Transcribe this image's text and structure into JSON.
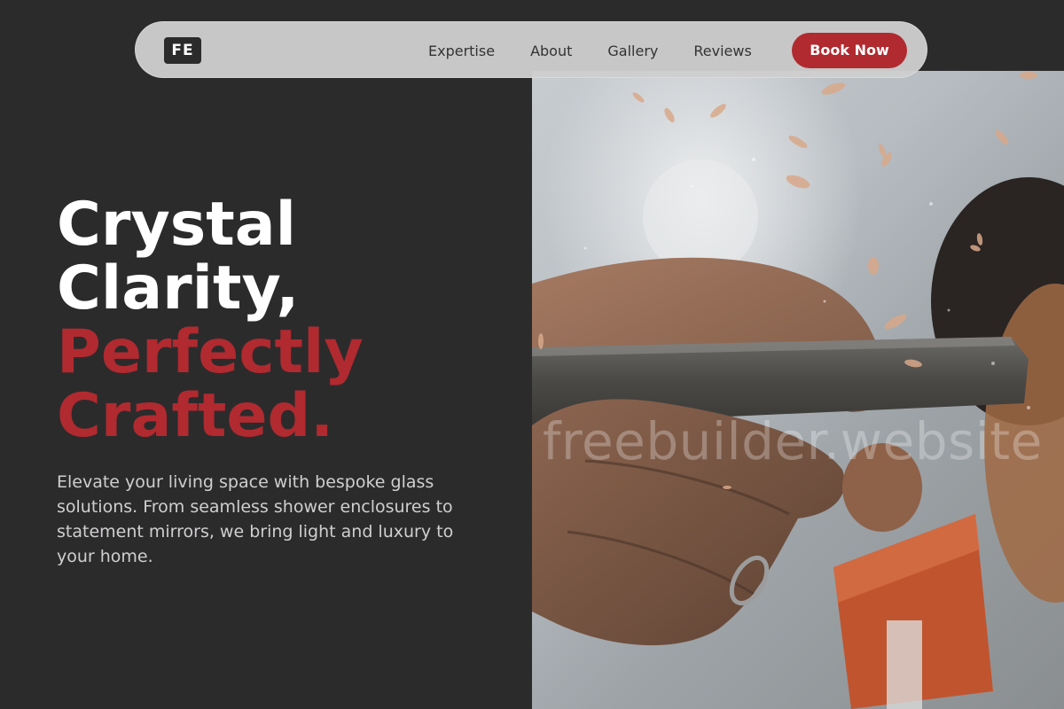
{
  "navbar": {
    "logo_text": "FE",
    "links": [
      "Expertise",
      "About",
      "Gallery",
      "Reviews"
    ],
    "cta_label": "Book Now"
  },
  "hero": {
    "headline_line1": "Crystal",
    "headline_line2": "Clarity,",
    "headline_line3": "Perfectly",
    "headline_line4": "Crafted.",
    "subtext": "Elevate your living space with bespoke glass solutions. From seamless shower enclosures to statement mirrors, we bring light and luxury to your home.",
    "image_alt": "Craftsman hands working a chisel with flying wood shavings",
    "watermark": "freebuilder.website"
  },
  "colors": {
    "background": "#2c2b2c",
    "accent": "#b02a30",
    "navbar": "#cecece"
  }
}
